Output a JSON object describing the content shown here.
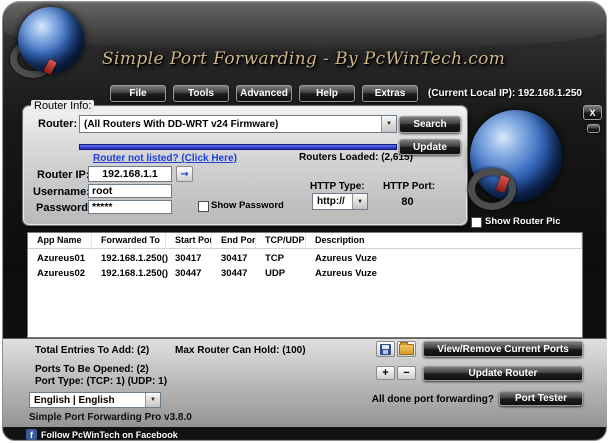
{
  "window": {
    "title": "Simple Port Forwarding - By PcWinTech.com",
    "version": "Simple Port Forwarding Pro v3.8.0"
  },
  "icons": {
    "close": "X",
    "dropdown_arrow": "▼",
    "detect_arrow": "→",
    "facebook_f": "f",
    "add": "+",
    "remove": "−"
  },
  "colors": {
    "link_blue": "#1f3fd8",
    "progress_blue": "#2433cc",
    "facebook_blue": "#3b5998",
    "title_gold": "#cfb488"
  },
  "menu": {
    "items": [
      "File",
      "Tools",
      "Advanced",
      "Help",
      "Extras"
    ],
    "current_ip": "(Current Local IP): 192.168.1.250"
  },
  "router_info": {
    "legend": "Router Info:",
    "router_label": "Router:",
    "router_selected": "(All Routers With DD-WRT v24 Firmware)",
    "search": "Search",
    "not_listed_link": "Router not listed? (Click Here)",
    "routers_loaded": "Routers Loaded: (2,615)",
    "update": "Update",
    "router_ip_label": "Router IP:",
    "router_ip": "192.168.1.1",
    "username_label": "Username:",
    "username": "root",
    "password_label": "Password:",
    "password_masked": "*****",
    "show_password": "Show Password",
    "http_type_label": "HTTP Type:",
    "http_type": "http://",
    "http_port_label": "HTTP Port:",
    "http_port": "80",
    "show_router_pic": "Show Router Pic"
  },
  "ports_table": {
    "columns": [
      "App Name",
      "Forwarded To",
      "Start Port",
      "End Port",
      "TCP/UDP",
      "Description"
    ],
    "rows": [
      [
        "Azureus01",
        "192.168.1.250()",
        "30417",
        "30417",
        "TCP",
        "Azureus Vuze"
      ],
      [
        "Azureus02",
        "192.168.1.250()",
        "30447",
        "30447",
        "UDP",
        "Azureus Vuze"
      ]
    ]
  },
  "summary": {
    "total_entries": "Total Entries To Add: (2)",
    "max_hold": "Max Router Can Hold: (100)",
    "ports_to_open": "Ports To Be Opened: (2)",
    "port_type": "Port Type: (TCP: 1) (UDP: 1)"
  },
  "actions": {
    "view_remove": "View/Remove Current Ports",
    "update_router": "Update Router",
    "all_done": "All done port forwarding?",
    "port_tester": "Port Tester",
    "language": "English | English"
  },
  "footer": {
    "facebook": "Follow PcWinTech on Facebook"
  }
}
